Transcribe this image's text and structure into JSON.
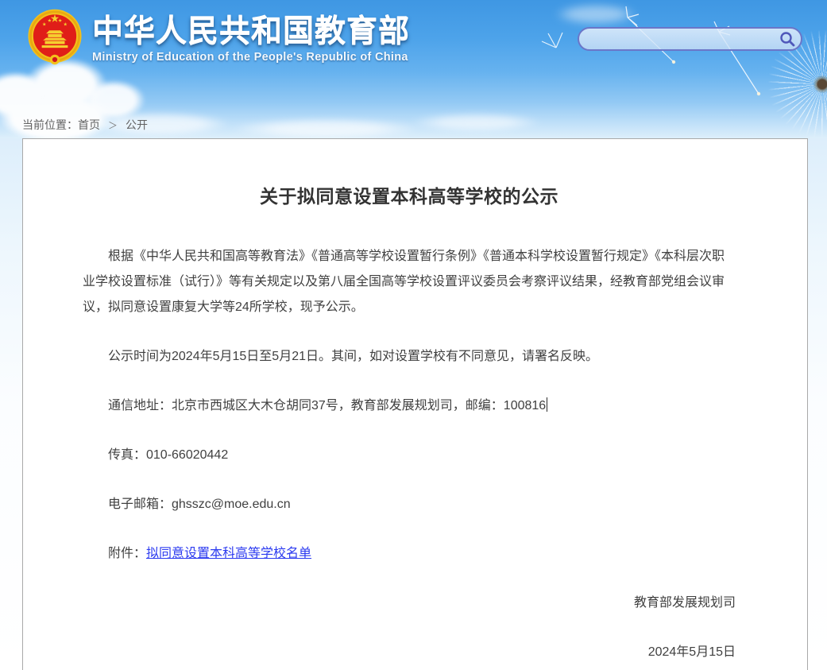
{
  "header": {
    "site_name": "中华人民共和国教育部",
    "site_name_en": "Ministry of Education of the People's Republic of China",
    "search": {
      "value": "",
      "icon": "magnifier-icon"
    },
    "emblem_icon": "china-national-emblem"
  },
  "breadcrumb": {
    "label": "当前位置：",
    "home": "首页",
    "separator": "＞",
    "current": "公开"
  },
  "article": {
    "title": "关于拟同意设置本科高等学校的公示",
    "paragraphs": [
      "根据《中华人民共和国高等教育法》《普通高等学校设置暂行条例》《普通本科学校设置暂行规定》《本科层次职业学校设置标准（试行）》等有关规定以及第八届全国高等学校设置评议委员会考察评议结果，经教育部党组会议审议，拟同意设置康复大学等24所学校，现予公示。",
      "公示时间为2024年5月15日至5月21日。其间，如对设置学校有不同意见，请署名反映。"
    ],
    "contact": {
      "address_line": "通信地址：北京市西城区大木仓胡同37号，教育部发展规划司，邮编：100816",
      "fax_line": "传真：010-66020442",
      "email_line": "电子邮箱：ghsszc@moe.edu.cn"
    },
    "attachment": {
      "label": "附件：",
      "link_text": "拟同意设置本科高等学校名单"
    },
    "signature": "教育部发展规划司",
    "date": "2024年5月15日"
  },
  "colors": {
    "sky_top": "#3f97e3",
    "sky_bottom": "#ddeffb",
    "search_border": "#6b76c8",
    "search_icon": "#4f58ba",
    "panel_border": "#a9a9a9",
    "body_text": "#404040",
    "title_text": "#333333",
    "link_blue": "#2b3af0",
    "emblem_red": "#e01e18",
    "emblem_gold": "#f3c11b"
  }
}
